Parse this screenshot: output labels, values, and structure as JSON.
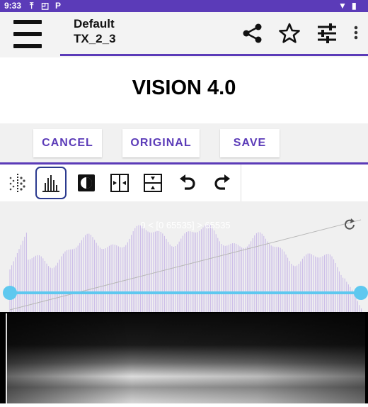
{
  "status_bar": {
    "time": "9:33",
    "left_icons": [
      "upload-icon",
      "cast-icon",
      "parking-icon"
    ],
    "right_icons": [
      "wifi-icon",
      "battery-icon"
    ]
  },
  "app_bar": {
    "title": "Default",
    "subtitle": "TX_2_3",
    "icons": [
      "menu-icon",
      "share-icon",
      "star-icon",
      "tune-icon",
      "more-vert-icon"
    ]
  },
  "heading": "VISION 4.0",
  "buttons": {
    "cancel": "CANCEL",
    "original": "ORIGINAL",
    "save": "SAVE"
  },
  "tools": [
    {
      "name": "dither-icon",
      "active": false
    },
    {
      "name": "histogram-icon",
      "active": true
    },
    {
      "name": "contrast-icon",
      "active": false
    },
    {
      "name": "compress-horizontal-icon",
      "active": false
    },
    {
      "name": "compress-vertical-icon",
      "active": false
    },
    {
      "name": "undo-icon",
      "active": false
    },
    {
      "name": "redo-icon",
      "active": false
    }
  ],
  "histogram": {
    "range_text": "0 < [0 65535] > 65535",
    "refresh_icon": "refresh-icon",
    "bar_color": "#c9b8e8",
    "slider_color": "#5ec8ef",
    "min_level": 0,
    "max_level": 1
  },
  "colors": {
    "accent": "#5b3bb8",
    "status_bar": "#5b3bb8"
  }
}
